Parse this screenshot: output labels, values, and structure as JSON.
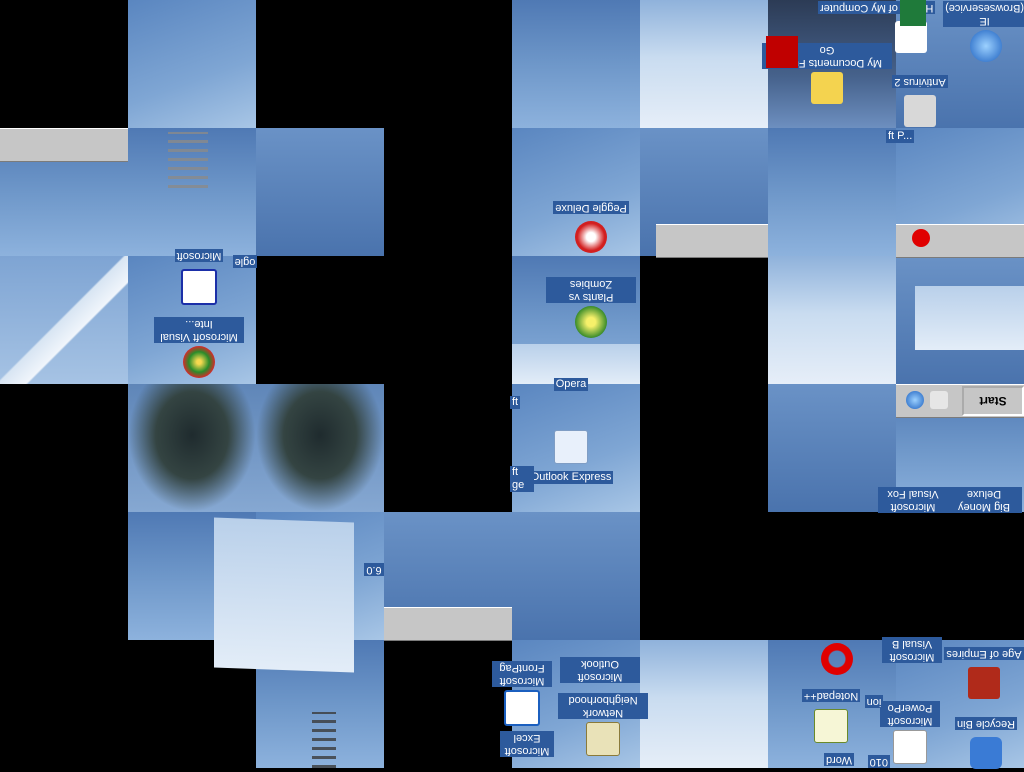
{
  "desktop": {
    "taskbar": {
      "start_label": "Start"
    },
    "icons": [
      {
        "id": "my-computer",
        "label": "My Computer",
        "flipped": true
      },
      {
        "id": "my-documents",
        "label": "My Documents Fucker Go",
        "flipped": true
      },
      {
        "id": "hearts",
        "label": "Hearts of",
        "flipped": true
      },
      {
        "id": "ie",
        "label": "IE (Browseservice)",
        "flipped": true
      },
      {
        "id": "antivirus",
        "label": "Antivirus 2",
        "flipped": true
      },
      {
        "id": "ms-p",
        "label": "ft P...",
        "flipped": false
      },
      {
        "id": "peggle",
        "label": "Peggle Deluxe",
        "flipped": true
      },
      {
        "id": "plants-zombies",
        "label": "Plants vs Zombies",
        "flipped": true
      },
      {
        "id": "opera",
        "label": "Opera",
        "flipped": false
      },
      {
        "id": "outlook-express",
        "label": "Outlook Express",
        "flipped": false
      },
      {
        "id": "ms-word-top",
        "label": "Microsoft",
        "flipped": true
      },
      {
        "id": "google",
        "label": "ogle",
        "flipped": true
      },
      {
        "id": "ms-visual-inter",
        "label": "Microsoft Visual Inte...",
        "flipped": true
      },
      {
        "id": "big-money",
        "label": "Big Money Deluxe",
        "flipped": true
      },
      {
        "id": "ms-visual-fox",
        "label": "Microsoft Visual Fox",
        "flipped": true
      },
      {
        "id": "ie-version",
        "label": "6.0",
        "flipped": true
      },
      {
        "id": "age-empires",
        "label": "Age of Empires",
        "flipped": true
      },
      {
        "id": "ms-visual-b",
        "label": "Microsoft Visual B",
        "flipped": true
      },
      {
        "id": "recycle-bin",
        "label": "Recycle Bin",
        "flipped": true
      },
      {
        "id": "ms-powerpoint",
        "label": "Microsoft PowerPo",
        "flipped": true
      },
      {
        "id": "ms-frontpage",
        "label": "Microsoft FrontPag",
        "flipped": true
      },
      {
        "id": "ms-outlook",
        "label": "Microsoft Outlook",
        "flipped": true
      },
      {
        "id": "network-neighborhood",
        "label": "Network Neighborhood",
        "flipped": true
      },
      {
        "id": "ms-excel",
        "label": "Microsoft Excel",
        "flipped": true
      },
      {
        "id": "notepad",
        "label": "Notepad++",
        "flipped": true
      },
      {
        "id": "word",
        "label": "Word",
        "flipped": true
      },
      {
        "id": "ion",
        "label": "ion",
        "flipped": true
      },
      {
        "id": "office-2010",
        "label": "010",
        "flipped": true
      },
      {
        "id": "soft-left",
        "label": "ft",
        "flipped": false
      },
      {
        "id": "soft-left2",
        "label": "ft ge",
        "flipped": false
      }
    ]
  }
}
